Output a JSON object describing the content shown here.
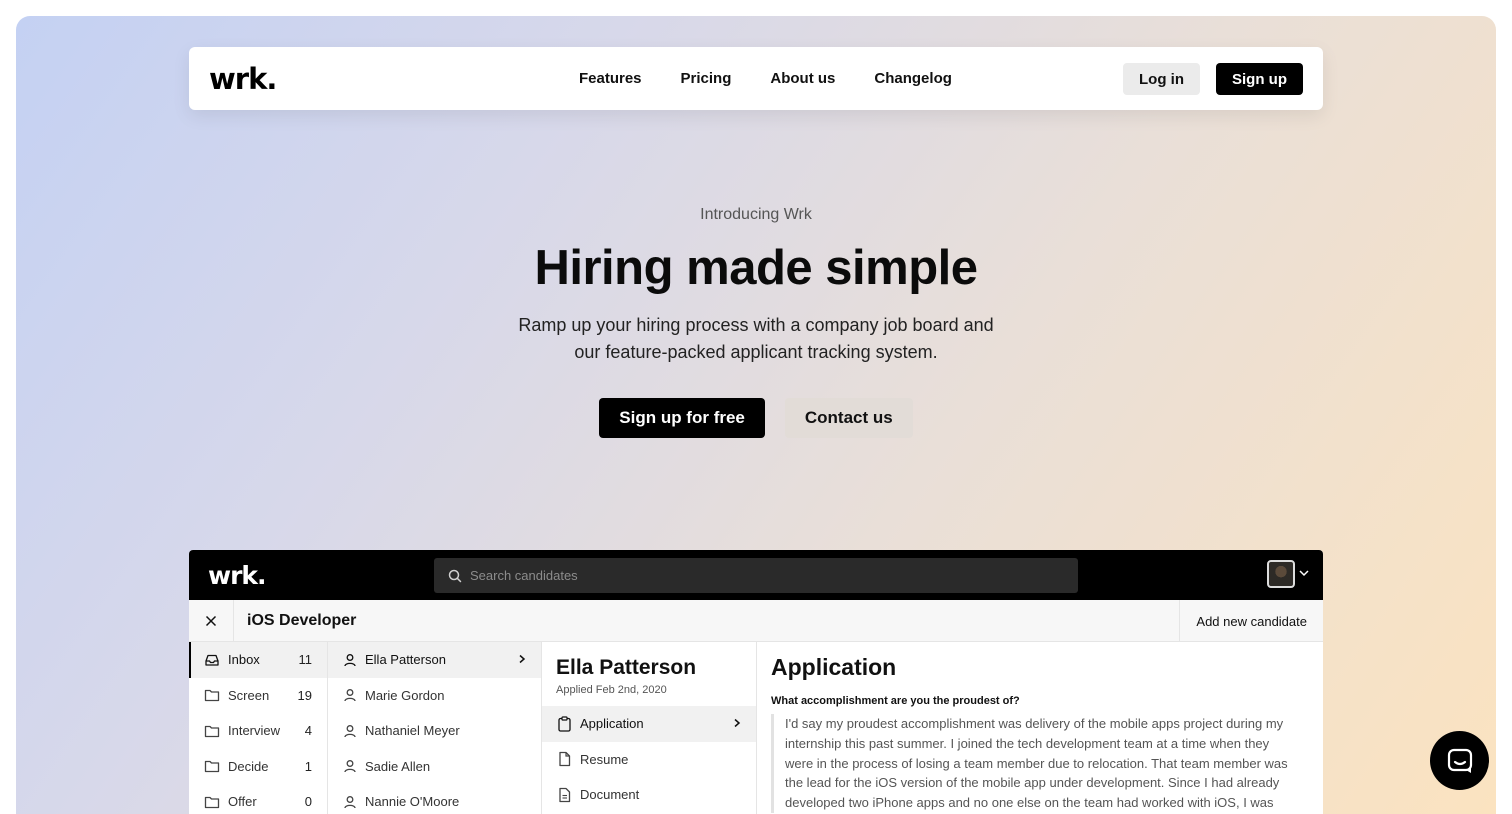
{
  "nav": {
    "logo": "wrk.",
    "links": [
      "Features",
      "Pricing",
      "About us",
      "Changelog"
    ],
    "login_label": "Log in",
    "signup_label": "Sign up"
  },
  "hero": {
    "eyebrow": "Introducing Wrk",
    "headline": "Hiring made simple",
    "subline_1": "Ramp up your hiring process with a company job board and",
    "subline_2": "our feature-packed applicant tracking system.",
    "primary_cta": "Sign up for free",
    "secondary_cta": "Contact us"
  },
  "app": {
    "logo": "wrk.",
    "search_placeholder": "Search candidates",
    "job_title": "iOS Developer",
    "add_candidate_label": "Add new candidate",
    "stages": [
      {
        "label": "Inbox",
        "count": "11",
        "icon": "inbox-icon"
      },
      {
        "label": "Screen",
        "count": "19",
        "icon": "folder-icon"
      },
      {
        "label": "Interview",
        "count": "4",
        "icon": "folder-icon"
      },
      {
        "label": "Decide",
        "count": "1",
        "icon": "folder-icon"
      },
      {
        "label": "Offer",
        "count": "0",
        "icon": "folder-icon"
      }
    ],
    "candidates": [
      "Ella Patterson",
      "Marie Gordon",
      "Nathaniel Meyer",
      "Sadie Allen",
      "Nannie O'Moore"
    ],
    "selected_candidate": {
      "name": "Ella Patterson",
      "applied": "Applied Feb 2nd, 2020"
    },
    "sections": [
      {
        "label": "Application",
        "icon": "clipboard-icon"
      },
      {
        "label": "Resume",
        "icon": "file-icon"
      },
      {
        "label": "Document",
        "icon": "document-icon"
      }
    ],
    "application": {
      "title": "Application",
      "question": "What accomplishment are you the proudest of?",
      "answer_lines": [
        "I'd say my proudest accomplishment was delivery of the mobile apps project during my",
        "internship this past summer. I joined the tech development team at a time when they",
        "were in the process of losing a team member due to relocation. That team member was",
        "the lead for the iOS version of the mobile app under development. Since I had already",
        "developed two iPhone apps and no one else on the team had worked with iOS, I was"
      ]
    }
  },
  "colors": {
    "accent": "#000000",
    "gradient_start": "#c4d1f3",
    "gradient_end": "#fbe3c0"
  }
}
